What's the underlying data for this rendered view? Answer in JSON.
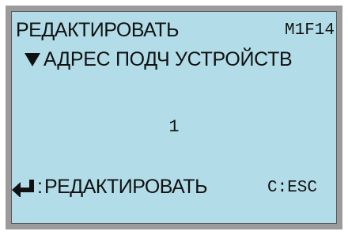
{
  "screen": {
    "title": "РЕДАКТИРОВАТЬ",
    "menu_code": "M1F14",
    "parameter_name": "АДРЕС ПОДЧ УСТРОЙСТВ",
    "value": "1",
    "footer": {
      "enter_colon": ":",
      "enter_action": "РЕДАКТИРОВАТЬ",
      "cancel_hint": "C:ESC"
    }
  },
  "colors": {
    "lcd_background": "#b2dde8",
    "bezel": "#9b9b9b",
    "text": "#111111"
  },
  "icons": [
    "down-triangle-icon",
    "enter-arrow-icon"
  ]
}
